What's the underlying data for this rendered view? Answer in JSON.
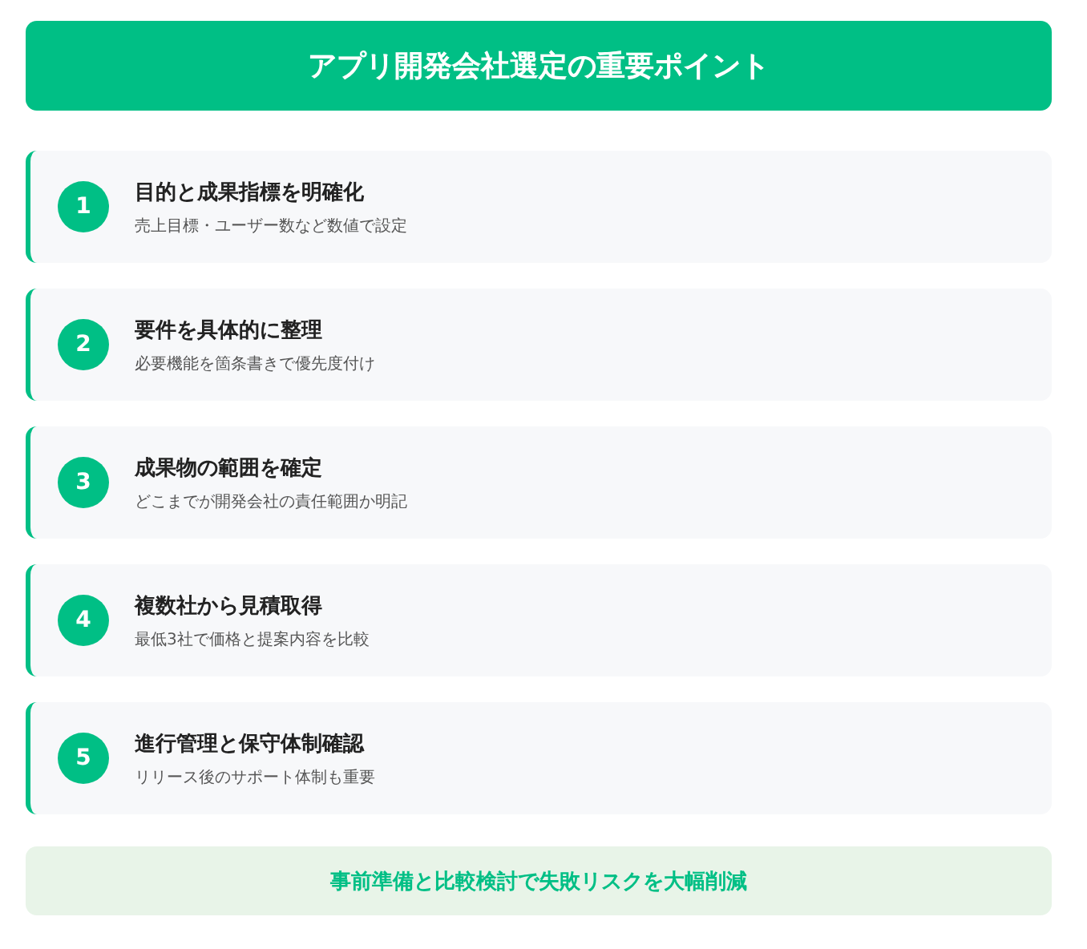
{
  "header": {
    "title": "アプリ開発会社選定の重要ポイント"
  },
  "points": [
    {
      "number": "1",
      "title": "目的と成果指標を明確化",
      "description": "売上目標・ユーザー数など数値で設定"
    },
    {
      "number": "2",
      "title": "要件を具体的に整理",
      "description": "必要機能を箇条書きで優先度付け"
    },
    {
      "number": "3",
      "title": "成果物の範囲を確定",
      "description": "どこまでが開発会社の責任範囲か明記"
    },
    {
      "number": "4",
      "title": "複数社から見積取得",
      "description": "最低3社で価格と提案内容を比較"
    },
    {
      "number": "5",
      "title": "進行管理と保守体制確認",
      "description": "リリース後のサポート体制も重要"
    }
  ],
  "summary": {
    "text": "事前準備と比較検討で失敗リスクを大幅削減"
  }
}
